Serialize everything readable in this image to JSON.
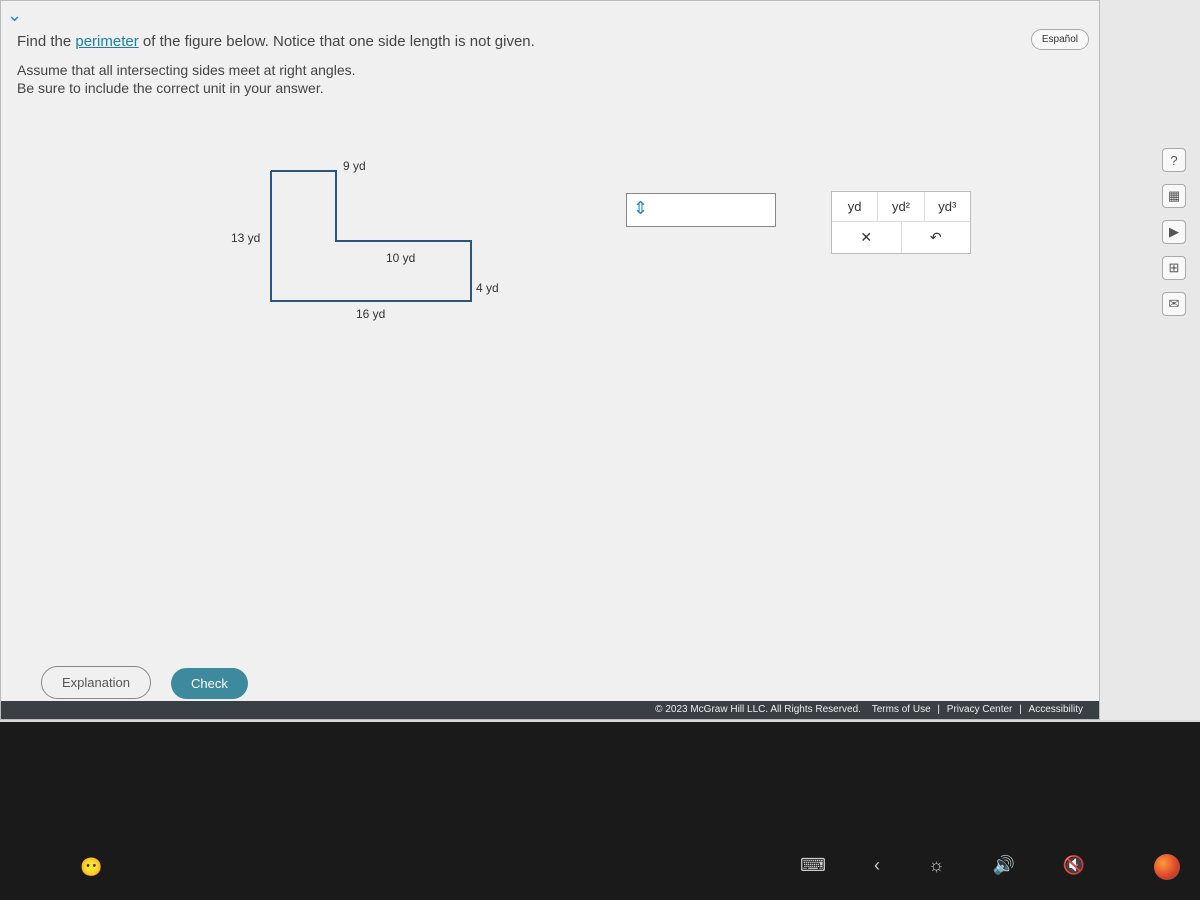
{
  "question": {
    "line1_pre": "Find the ",
    "line1_link": "perimeter",
    "line1_post": " of the figure below. Notice that one side length is not given.",
    "line2": "Assume that all intersecting sides meet at right angles.\nBe sure to include the correct unit in your answer."
  },
  "figure": {
    "labels": {
      "left": "13 yd",
      "top_small": "9 yd",
      "inner_h": "10 yd",
      "right_small": "4 yd",
      "bottom": "16 yd"
    }
  },
  "answer": {
    "value": "",
    "cursor_icon": "⇕"
  },
  "units": {
    "u1": "yd",
    "u2": "yd²",
    "u3": "yd³"
  },
  "controls": {
    "clear": "✕",
    "undo": "↶"
  },
  "lang_button": "Español",
  "sidebar_icons": {
    "help": "?",
    "calc": "▦",
    "play": "▶",
    "grid": "⊞",
    "mail": "✉"
  },
  "buttons": {
    "explanation": "Explanation",
    "check": "Check"
  },
  "footer": {
    "copyright": "© 2023 McGraw Hill LLC. All Rights Reserved.",
    "terms": "Terms of Use",
    "privacy": "Privacy Center",
    "accessibility": "Accessibility"
  },
  "taskbar": {
    "keyboard": "⌨",
    "back": "‹",
    "brightness": "☼",
    "volume": "🔊",
    "mute": "🔇"
  }
}
